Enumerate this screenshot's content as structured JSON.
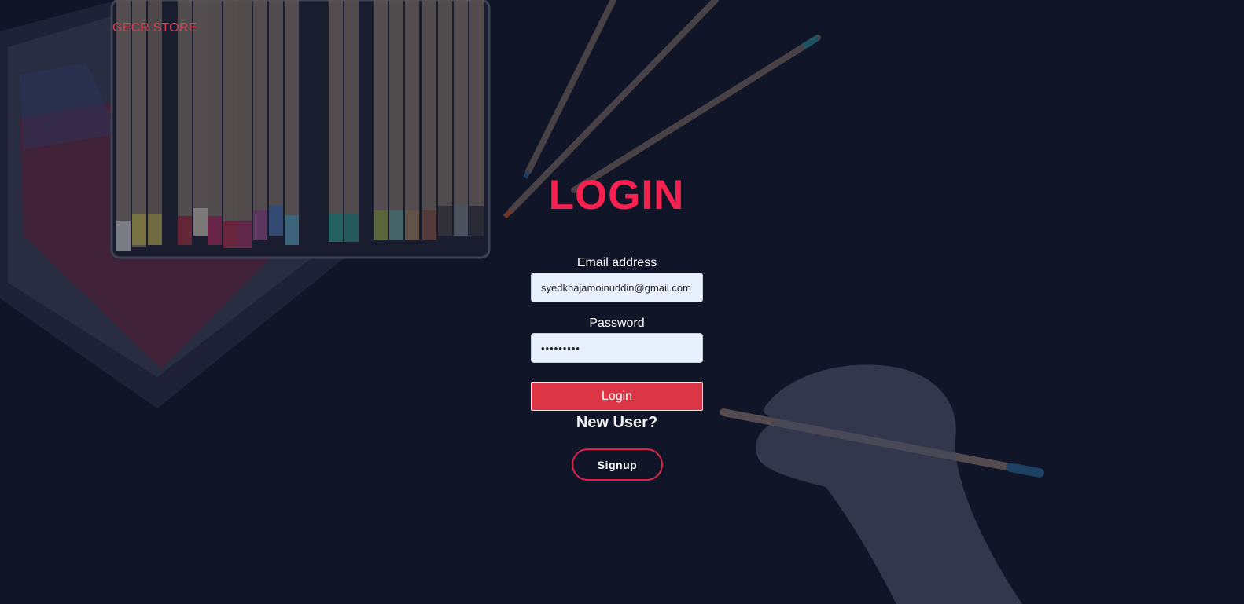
{
  "brand": {
    "name": "GECR STORE"
  },
  "page": {
    "title": "LOGIN"
  },
  "form": {
    "email": {
      "label": "Email address",
      "value": "syedkhajamoinuddin@gmail.com"
    },
    "password": {
      "label": "Password",
      "value": "password1"
    },
    "login_label": "Login",
    "new_user_text": "New User?",
    "signup_label": "Signup"
  },
  "colors": {
    "background": "#121729",
    "accent": "#f5214f",
    "button": "#dc3545",
    "input_bg": "#e8f0fe"
  }
}
